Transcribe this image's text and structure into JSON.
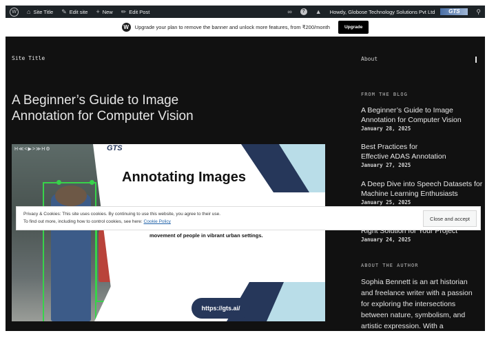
{
  "adminbar": {
    "site_title": "Site Title",
    "edit_site": "Edit site",
    "new": "New",
    "edit_post": "Edit Post",
    "howdy": "Howdy, Globose Technology Solutions Pvt Ltd",
    "logo_text": "GTS",
    "icons": [
      "wordpress-icon",
      "home-icon",
      "brush-icon",
      "plus-icon",
      "pencil-icon",
      "reader-icon",
      "help-icon",
      "notifications-icon",
      "search-icon"
    ]
  },
  "banner": {
    "text": "Upgrade your plan to remove the banner and unlock more features, from ₹200/month",
    "button": "Upgrade"
  },
  "site": {
    "title": "Site Title",
    "post_title": "A Beginner’s Guide to Image Annotation for Computer Vision"
  },
  "featured_image": {
    "controls": "H≪<▶>≫H⚙",
    "badge": "GTS",
    "heading": "Annotating Images",
    "caption": "hustle and energy through dynamic architecture and the movement of people in vibrant urban settings.",
    "url": "https://gts.ai/"
  },
  "sidebar": {
    "about": "About",
    "from_the_blog": "FROM THE BLOG",
    "posts": [
      {
        "title": "A Beginner’s Guide to Image Annotation for Computer Vision",
        "date": "January 28, 2025"
      },
      {
        "title": "Best Practices for Effective ADAS Annotation",
        "date": "January 27, 2025"
      },
      {
        "title": "A Deep Dive into Speech Datasets for Machine Learning Enthusiasts",
        "date": "January 25, 2025"
      },
      {
        "title": "Right Solution for Your Project",
        "date": "January 24, 2025"
      }
    ],
    "about_the_author": "ABOUT THE AUTHOR",
    "author_bio": "Sophia Bennett is an art historian and freelance writer with a passion for exploring the intersections between nature, symbolism, and artistic expression. With a"
  },
  "cookie": {
    "line1": "Privacy & Cookies: This site uses cookies. By continuing to use this website, you agree to their use.",
    "line2_prefix": "To find out more, including how to control cookies, see here:",
    "link": "Cookie Policy",
    "accept": "Close and accept"
  },
  "colors": {
    "background": "#111111",
    "admin_bar": "#1d2327",
    "accent_navy": "#26375a",
    "annotation_green": "#37d34a"
  }
}
